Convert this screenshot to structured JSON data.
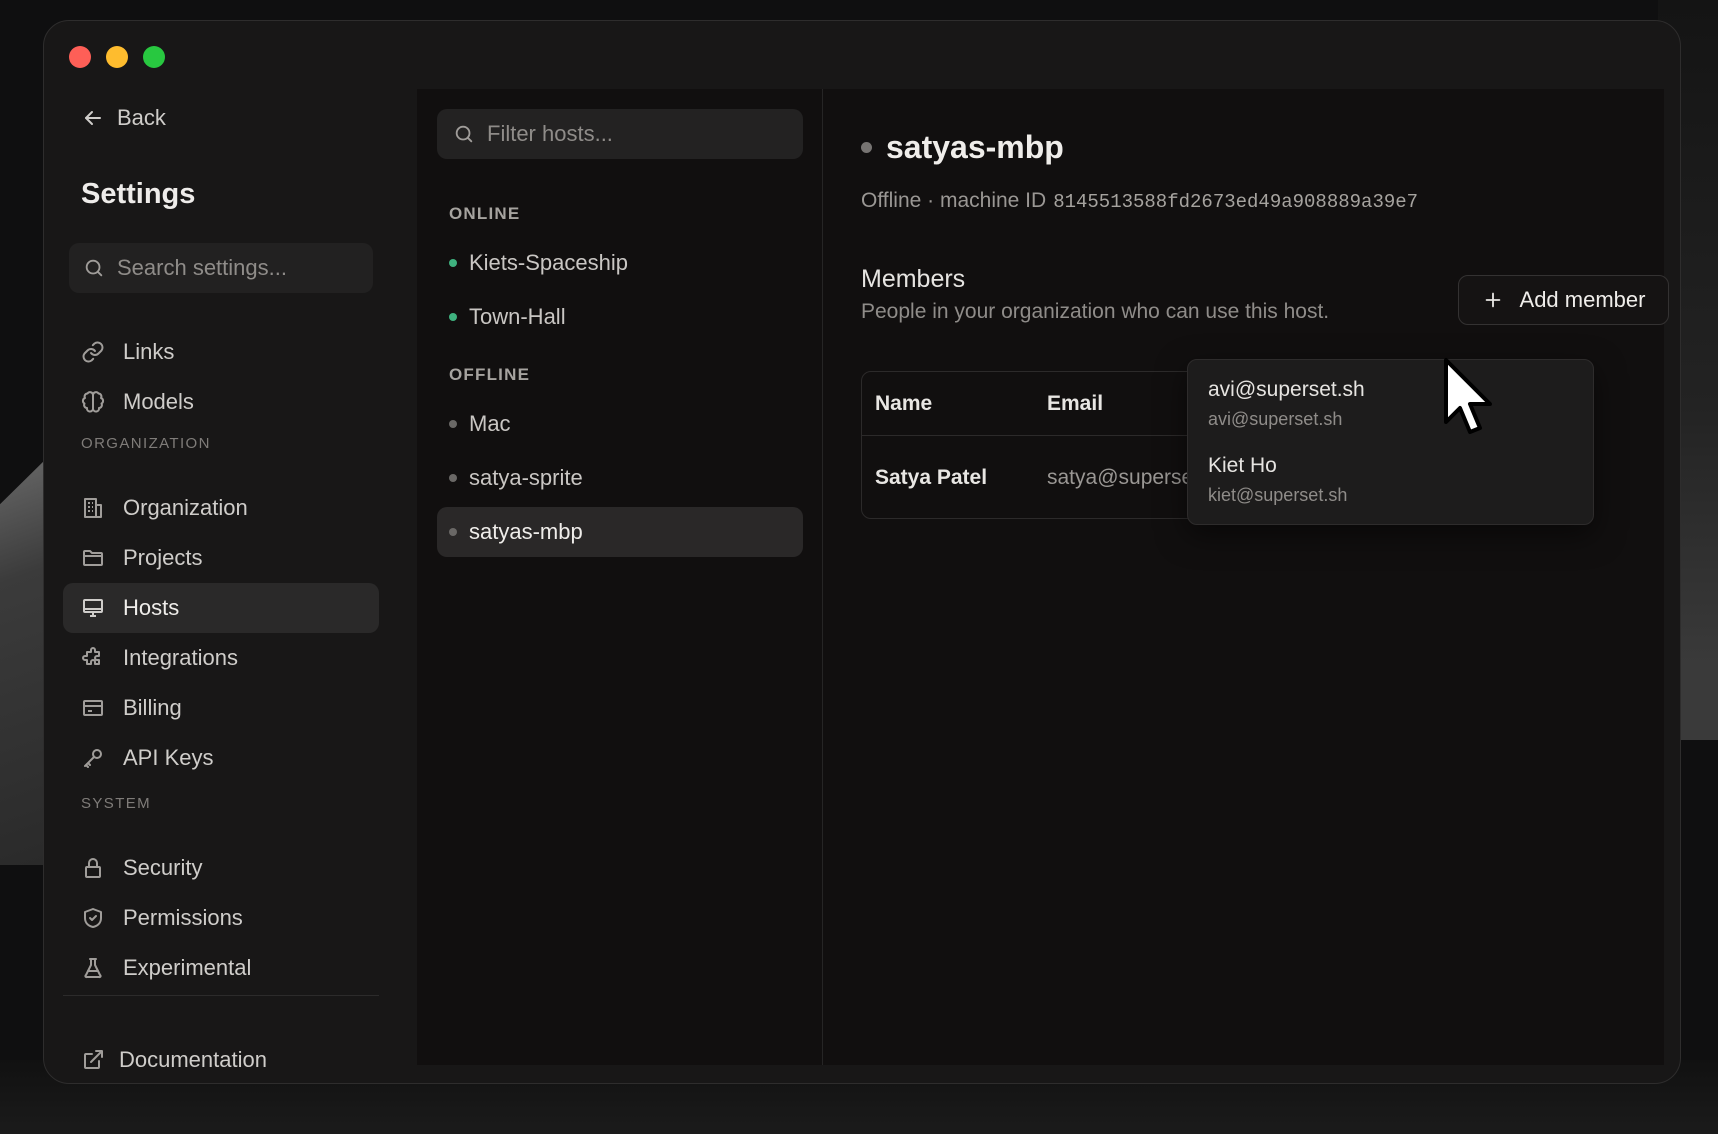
{
  "window": {
    "controls": [
      "close",
      "minimize",
      "zoom"
    ]
  },
  "sidebar": {
    "back_label": "Back",
    "title": "Settings",
    "search_placeholder": "Search settings...",
    "top_items": [
      {
        "label": "Links",
        "icon": "link-icon"
      },
      {
        "label": "Models",
        "icon": "brain-icon"
      }
    ],
    "organization_label": "ORGANIZATION",
    "organization_items": [
      {
        "label": "Organization",
        "icon": "building-icon"
      },
      {
        "label": "Projects",
        "icon": "folder-icon"
      },
      {
        "label": "Hosts",
        "icon": "monitor-icon",
        "active": true
      },
      {
        "label": "Integrations",
        "icon": "puzzle-icon"
      },
      {
        "label": "Billing",
        "icon": "credit-card-icon"
      },
      {
        "label": "API Keys",
        "icon": "key-icon"
      }
    ],
    "system_label": "SYSTEM",
    "system_items": [
      {
        "label": "Security",
        "icon": "lock-icon"
      },
      {
        "label": "Permissions",
        "icon": "shield-icon"
      },
      {
        "label": "Experimental",
        "icon": "flask-icon"
      }
    ],
    "documentation_label": "Documentation"
  },
  "hosts": {
    "filter_placeholder": "Filter hosts...",
    "online_label": "ONLINE",
    "online": [
      "Kiets-Spaceship",
      "Town-Hall"
    ],
    "offline_label": "OFFLINE",
    "offline": [
      "Mac",
      "satya-sprite",
      "satyas-mbp"
    ],
    "selected": "satyas-mbp"
  },
  "detail": {
    "host_name": "satyas-mbp",
    "status": "Offline · machine ID",
    "machine_id": "8145513588fd2673ed49a908889a39e7",
    "members_title": "Members",
    "members_desc": "People in your organization who can use this host.",
    "add_member_label": "Add member",
    "table": {
      "headers": [
        "Name",
        "Email"
      ],
      "rows": [
        {
          "name": "Satya Patel",
          "email": "satya@superse"
        }
      ]
    },
    "dropdown": [
      {
        "primary": "avi@superset.sh",
        "secondary": "avi@superset.sh"
      },
      {
        "primary": "Kiet Ho",
        "secondary": "kiet@superset.sh"
      }
    ]
  },
  "colors": {
    "online": "#3fb27f",
    "offline": "#6a6866",
    "close": "#fe5f57",
    "minimize": "#febc2e",
    "zoom": "#28c840"
  }
}
